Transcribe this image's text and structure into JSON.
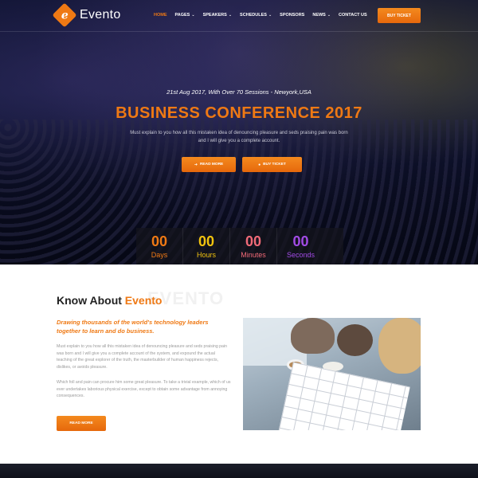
{
  "brand": {
    "logo_letter": "e",
    "name": "Evento"
  },
  "nav": {
    "items": [
      {
        "label": "HOME",
        "active": true,
        "dropdown": false
      },
      {
        "label": "PAGES",
        "active": false,
        "dropdown": true
      },
      {
        "label": "SPEAKERS",
        "active": false,
        "dropdown": true
      },
      {
        "label": "SCHEDULES",
        "active": false,
        "dropdown": true
      },
      {
        "label": "SPONSORS",
        "active": false,
        "dropdown": false
      },
      {
        "label": "NEWS",
        "active": false,
        "dropdown": true
      },
      {
        "label": "CONTACT US",
        "active": false,
        "dropdown": false
      }
    ],
    "dropdown_icon": "chevron-down-icon",
    "buy_ticket_label": "BUY TICKET"
  },
  "hero": {
    "date_line": "21st Aug 2017, With Over 70 Sessions - Newyork,USA",
    "title": "BUSINESS CONFERENCE 2017",
    "description": "Must explain to you how all this mistaken idea of denouncing pleasure and seds praising pain was born and I will give you a complete account.",
    "read_more_label": "READ MORE",
    "read_more_icon": "arrow-circle-icon",
    "buy_ticket_label": "BUY TICKET",
    "buy_ticket_icon": "ticket-circle-icon"
  },
  "countdown": [
    {
      "value": "00",
      "label": "Days",
      "color": "#ef7914"
    },
    {
      "value": "00",
      "label": "Hours",
      "color": "#f2c40f"
    },
    {
      "value": "00",
      "label": "Minutes",
      "color": "#f06a78"
    },
    {
      "value": "00",
      "label": "Seconds",
      "color": "#a24be6"
    }
  ],
  "about": {
    "heading_prefix": "Know About ",
    "heading_accent": "Evento",
    "ghost_text": "EVENTO",
    "lead": "Drawing thousands of the world's technology leaders together to learn and do business.",
    "paragraph1": "Must explain to you how all this mistaken idea of denouncing pleasure and seds praising pain was born and I will give you a complete account of the system, and expound the actual teaching of the great explorer of the truth, the masterbuilder of human happiness rejects, dislikes, or avoids pleasure.",
    "paragraph2": "Which foll and pain can procure him some great pleasure. To take a trivial example, which of us ever undertakes laborious physical exercise, except to obtain some advantage from annoying consequences.",
    "read_more_label": "READ MORE"
  },
  "colors": {
    "accent": "#ef7914",
    "hero_bg": "#101433"
  }
}
